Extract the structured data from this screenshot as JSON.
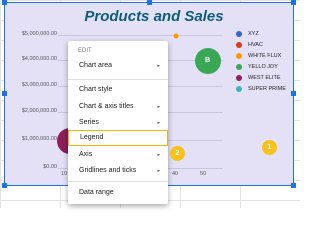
{
  "chart": {
    "title": "Products and Sales",
    "y_ticks": [
      "$5,000,000.00",
      "$4,000,000.00",
      "$3,000,000.00",
      "$2,000,000.00",
      "$1,000,000.00",
      "$0.00"
    ],
    "x_ticks": [
      "10",
      "40",
      "50"
    ],
    "bubble_label": "B",
    "legend": [
      {
        "label": "XYZ",
        "color": "#3366cc"
      },
      {
        "label": "HVAC",
        "color": "#dc3912"
      },
      {
        "label": "WHITE FLUX",
        "color": "#ff9900"
      },
      {
        "label": "YELLO JOY",
        "color": "#3aa757"
      },
      {
        "label": "WEST ELITE",
        "color": "#8e1f5a"
      },
      {
        "label": "SUPER PRIME",
        "color": "#3cb4c8"
      }
    ]
  },
  "menu": {
    "header": "EDIT",
    "items": [
      {
        "label": "Chart area",
        "arrow": "▸"
      },
      {
        "label": "Chart style",
        "arrow": ""
      },
      {
        "label": "Chart & axis titles",
        "arrow": "▸"
      },
      {
        "label": "Series",
        "arrow": "▸"
      },
      {
        "label": "Legend",
        "arrow": ""
      },
      {
        "label": "Axis",
        "arrow": "▸"
      },
      {
        "label": "Gridlines and ticks",
        "arrow": "▸"
      },
      {
        "label": "Data range",
        "arrow": ""
      }
    ]
  },
  "badges": [
    "1",
    "2"
  ],
  "colors": {
    "accent": "#1a73e8",
    "highlight": "#f6b500",
    "badge": "#f7c21a"
  }
}
